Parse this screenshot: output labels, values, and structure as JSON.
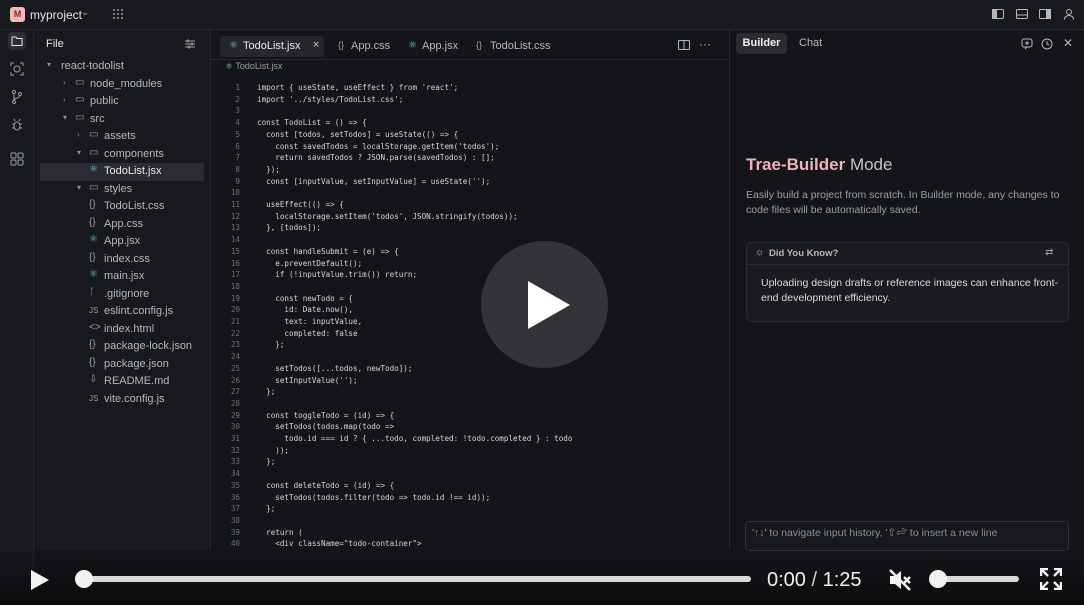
{
  "titlebar": {
    "project_initial": "M",
    "project_name": "myproject"
  },
  "explorer": {
    "title": "File",
    "items": [
      {
        "label": "react-todolist",
        "icon": "chevron"
      },
      {
        "label": "node_modules",
        "icon": "folder"
      },
      {
        "label": "public",
        "icon": "folder"
      },
      {
        "label": "src",
        "icon": "folder"
      },
      {
        "label": "assets",
        "icon": "folder"
      },
      {
        "label": "components",
        "icon": "folder"
      },
      {
        "label": "TodoList.jsx",
        "icon": "react"
      },
      {
        "label": "styles",
        "icon": "folder"
      },
      {
        "label": "TodoList.css",
        "icon": "braces"
      },
      {
        "label": "App.css",
        "icon": "braces"
      },
      {
        "label": "App.jsx",
        "icon": "react"
      },
      {
        "label": "index.css",
        "icon": "braces"
      },
      {
        "label": "main.jsx",
        "icon": "react"
      },
      {
        "label": ".gitignore",
        "icon": "git"
      },
      {
        "label": "eslint.config.js",
        "icon": "js"
      },
      {
        "label": "index.html",
        "icon": "html"
      },
      {
        "label": "package-lock.json",
        "icon": "braces"
      },
      {
        "label": "package.json",
        "icon": "braces"
      },
      {
        "label": "README.md",
        "icon": "download"
      },
      {
        "label": "vite.config.js",
        "icon": "js"
      }
    ]
  },
  "editor": {
    "tabs": [
      {
        "label": "TodoList.jsx",
        "icon": "react",
        "active": true
      },
      {
        "label": "App.css",
        "icon": "braces"
      },
      {
        "label": "App.jsx",
        "icon": "react"
      },
      {
        "label": "TodoList.css",
        "icon": "braces"
      }
    ],
    "breadcrumb": "TodoList.jsx",
    "lines": [
      "import { useState, useEffect } from 'react';",
      "import '../styles/TodoList.css';",
      "",
      "const TodoList = () => {",
      "  const [todos, setTodos] = useState(() => {",
      "    const savedTodos = localStorage.getItem('todos');",
      "    return savedTodos ? JSON.parse(savedTodos) : [];",
      "  });",
      "  const [inputValue, setInputValue] = useState('');",
      "",
      "  useEffect(() => {",
      "    localStorage.setItem('todos', JSON.stringify(todos));",
      "  }, [todos]);",
      "",
      "  const handleSubmit = (e) => {",
      "    e.preventDefault();",
      "    if (!inputValue.trim()) return;",
      "",
      "    const newTodo = {",
      "      id: Date.now(),",
      "      text: inputValue,",
      "      completed: false",
      "    };",
      "",
      "    setTodos([...todos, newTodo]);",
      "    setInputValue('');",
      "  };",
      "",
      "  const toggleTodo = (id) => {",
      "    setTodos(todos.map(todo =>",
      "      todo.id === id ? { ...todo, completed: !todo.completed } : todo",
      "    ));",
      "  };",
      "",
      "  const deleteTodo = (id) => {",
      "    setTodos(todos.filter(todo => todo.id !== id));",
      "  };",
      "",
      "  return (",
      "    <div className=\"todo-container\">"
    ]
  },
  "panel": {
    "tabs": [
      "Builder",
      "Chat"
    ],
    "hero_brand": "Trae-Builder",
    "hero_mode": "Mode",
    "description": "Easily build a project from scratch. In Builder mode, any changes to code files will be automatically saved.",
    "tip_title": "Did You Know?",
    "tip_body": "Uploading design drafts or reference images can enhance front-end development efficiency.",
    "input_placeholder": "'↑↓' to navigate input history, '⇧⏎' to insert a new line"
  },
  "video": {
    "current_time": "0:00",
    "duration": "1:25",
    "progress": 0.0,
    "muted": true
  }
}
